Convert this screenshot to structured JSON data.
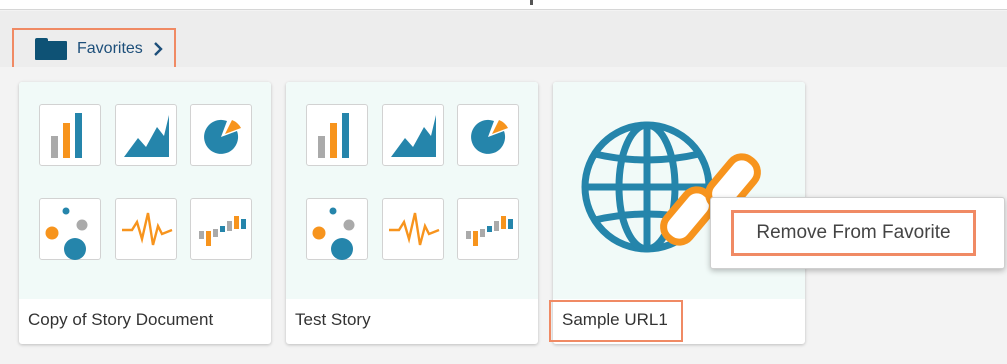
{
  "breadcrumb": {
    "label": "Favorites"
  },
  "cards": [
    {
      "name": "Copy of Story Document",
      "type": "story"
    },
    {
      "name": "Test Story",
      "type": "story"
    },
    {
      "name": "Sample URL1",
      "type": "url"
    }
  ],
  "context_menu": {
    "items": [
      {
        "label": "Remove From Favorite"
      }
    ]
  },
  "icons": {
    "breadcrumb": "folder-icon",
    "breadcrumb_chevron": "chevron-right-icon",
    "url_thumbnail": "globe-link-icon",
    "story_tiles": [
      "bar-chart-icon",
      "area-chart-icon",
      "pie-chart-icon",
      "bubble-chart-icon",
      "waveform-icon",
      "waterfall-chart-icon"
    ]
  },
  "colors": {
    "accent_blue": "#2585ab",
    "accent_orange": "#f7941d",
    "highlight": "#f08a64",
    "folder": "#0e5275",
    "breadcrumb_text": "#1d4f7a"
  }
}
